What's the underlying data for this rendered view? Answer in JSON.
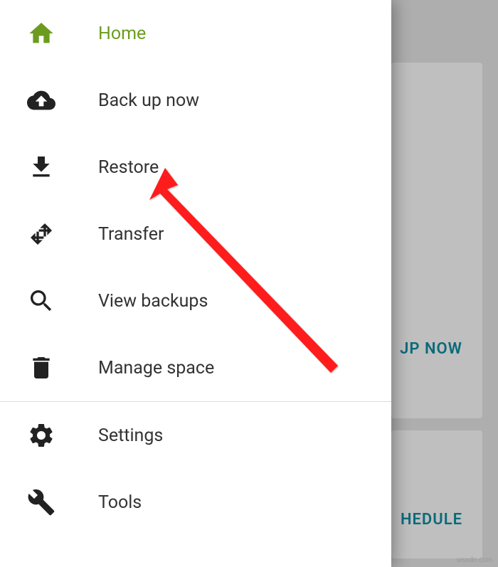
{
  "drawer": {
    "items": [
      {
        "label": "Home",
        "icon": "home"
      },
      {
        "label": "Back up now",
        "icon": "cloud-upload"
      },
      {
        "label": "Restore",
        "icon": "download"
      },
      {
        "label": "Transfer",
        "icon": "transfer"
      },
      {
        "label": "View backups",
        "icon": "search"
      },
      {
        "label": "Manage space",
        "icon": "delete"
      },
      {
        "label": "Settings",
        "icon": "settings"
      },
      {
        "label": "Tools",
        "icon": "wrench"
      }
    ]
  },
  "background": {
    "button1": "JP NOW",
    "button2": "HEDULE"
  },
  "watermark": "wsxdn.com"
}
